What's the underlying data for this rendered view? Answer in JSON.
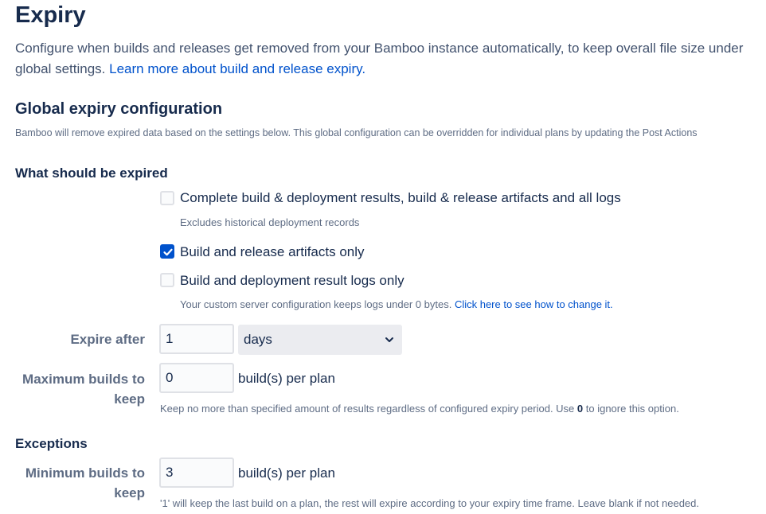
{
  "page": {
    "title": "Expiry",
    "intro_line1": "Configure when builds and releases get removed from your Bamboo instance automatically, to keep overall file size under",
    "intro_line2": "global settings. ",
    "intro_link": "Learn more about build and release expiry."
  },
  "global": {
    "title": "Global expiry configuration",
    "description": "Bamboo will remove expired data based on the settings below. This global configuration can be overridden for individual plans by updating the Post Actions"
  },
  "what_expire": {
    "heading": "What should be expired",
    "options": [
      {
        "label": "Complete build & deployment results, build & release artifacts and all logs",
        "checked": false,
        "description": "Excludes historical deployment records"
      },
      {
        "label": "Build and release artifacts only",
        "checked": true
      },
      {
        "label": "Build and deployment result logs only",
        "checked": false,
        "description": "Your custom server configuration keeps logs under 0 bytes. ",
        "description_link": "Click here to see how to change it."
      }
    ]
  },
  "expire_after": {
    "label": "Expire after",
    "value": "1",
    "unit_selected": "days"
  },
  "max_builds": {
    "label": "Maximum builds to keep",
    "value": "0",
    "unit": "build(s) per plan",
    "help_before": "Keep no more than specified amount of results regardless of configured expiry period. Use ",
    "help_bold": "0",
    "help_after": " to ignore this option."
  },
  "exceptions": {
    "heading": "Exceptions",
    "min_builds": {
      "label": "Minimum builds to keep",
      "value": "3",
      "unit": "build(s) per plan",
      "help": "'1' will keep the last build on a plan, the rest will expire according to your expiry time frame. Leave blank if not needed."
    }
  },
  "colors": {
    "text": "#172b4d",
    "subtle_text": "#5e6c84",
    "link": "#0052cc",
    "checkbox_checked": "#0052cc",
    "select_bg": "#ebecf0",
    "input_border": "#dfe1e6"
  },
  "icons": {
    "checkmark": "check-icon",
    "select_arrow": "chevron-down-icon"
  }
}
